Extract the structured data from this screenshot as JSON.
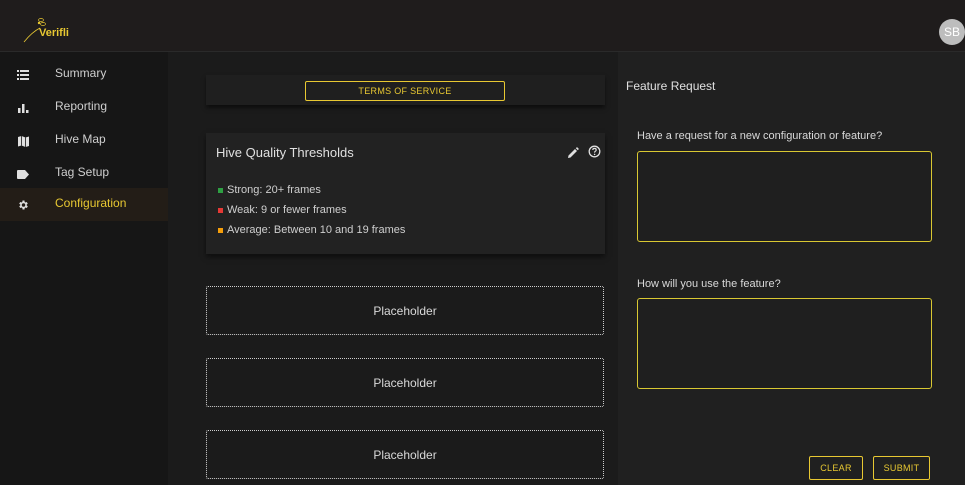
{
  "app": {
    "brand": "Verifli",
    "user_initials": "SB"
  },
  "sidebar": {
    "items": [
      {
        "label": "Summary",
        "icon": "list-icon"
      },
      {
        "label": "Reporting",
        "icon": "bar-chart-icon"
      },
      {
        "label": "Hive Map",
        "icon": "map-icon"
      },
      {
        "label": "Tag Setup",
        "icon": "tag-icon"
      },
      {
        "label": "Configuration",
        "icon": "gear-icon",
        "active": true
      }
    ]
  },
  "main": {
    "tos_label": "TERMS OF SERVICE",
    "thresholds": {
      "title": "Hive Quality Thresholds",
      "items": [
        {
          "label": "Strong: 20+ frames",
          "color": "#2ea043"
        },
        {
          "label": "Weak: 9 or fewer frames",
          "color": "#e53935"
        },
        {
          "label": "Average: Between 10 and 19 frames",
          "color": "#f59e0b"
        }
      ]
    },
    "placeholders": [
      "Placeholder",
      "Placeholder",
      "Placeholder"
    ]
  },
  "feature_request": {
    "title": "Feature Request",
    "question1": "Have a request for a new configuration or feature?",
    "question1_value": "",
    "question2": "How will you use the feature?",
    "question2_value": "",
    "clear_label": "CLEAR",
    "submit_label": "SUBMIT"
  },
  "colors": {
    "accent": "#e8c832",
    "background": "#121212",
    "card": "#222222"
  }
}
